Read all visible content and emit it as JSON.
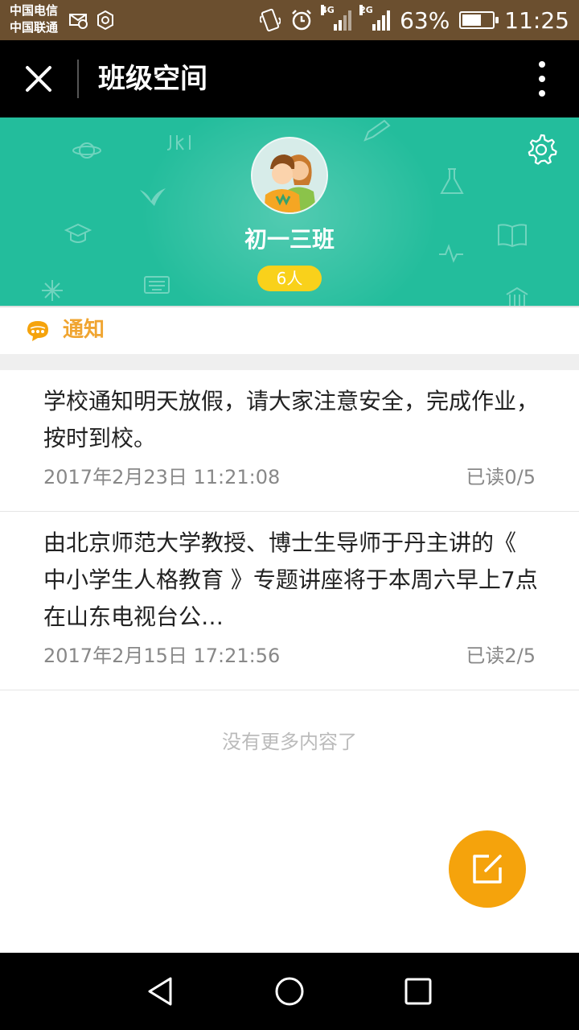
{
  "status_bar": {
    "carrier1": "中国电信",
    "carrier2": "中国联通",
    "net1": "4G",
    "net2": "2G",
    "battery_percent": "63%",
    "battery_level": 0.63,
    "time": "11:25"
  },
  "title_bar": {
    "title": "班级空间"
  },
  "class_header": {
    "name": "初一三班",
    "member_count": "6人"
  },
  "notice_tab": {
    "label": "通知"
  },
  "notices": [
    {
      "text": "学校通知明天放假，请大家注意安全，完成作业，按时到校。",
      "date": "2017年2月23日 11:21:08",
      "read": "已读0/5"
    },
    {
      "text": "由北京师范大学教授、博士生导师于丹主讲的《 中小学生人格教育 》专题讲座将于本周六早上7点在山东电视台公…",
      "date": "2017年2月15日 17:21:56",
      "read": "已读2/5"
    }
  ],
  "footer": {
    "no_more": "没有更多内容了"
  },
  "colors": {
    "header_bg": "#23bd9c",
    "accent_orange": "#f5a30c",
    "badge_yellow": "#f9d11b",
    "notice_label": "#f0a531"
  }
}
